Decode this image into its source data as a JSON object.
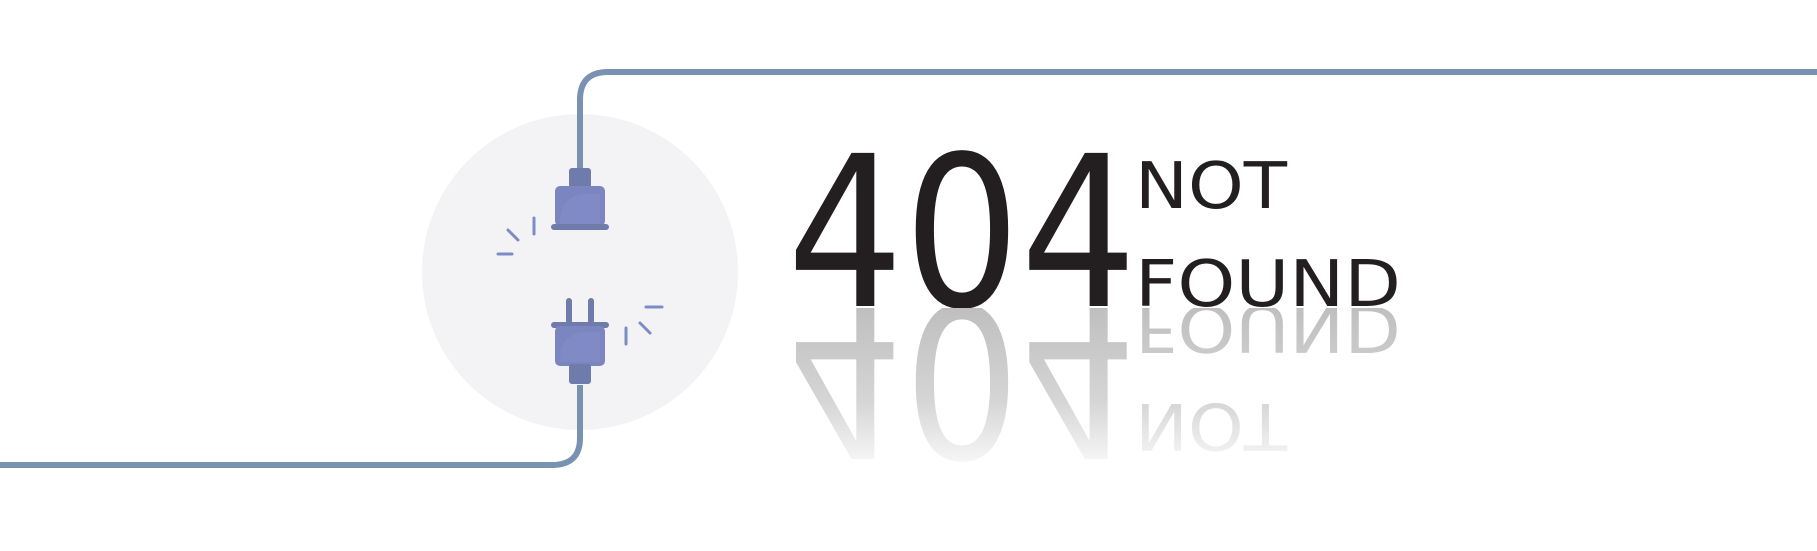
{
  "error": {
    "code": "404",
    "line1": "NOT",
    "line2": "FOUND"
  },
  "colors": {
    "wire": "#7a92b2",
    "circle": "#f3f3f6",
    "plug_body": "#7b86c1",
    "plug_dark": "#6f7cab",
    "text": "#231f20",
    "reflection": "#bfbfbf"
  },
  "icons": {
    "top_plug": "plug-socket-icon",
    "bottom_plug": "plug-icon"
  }
}
